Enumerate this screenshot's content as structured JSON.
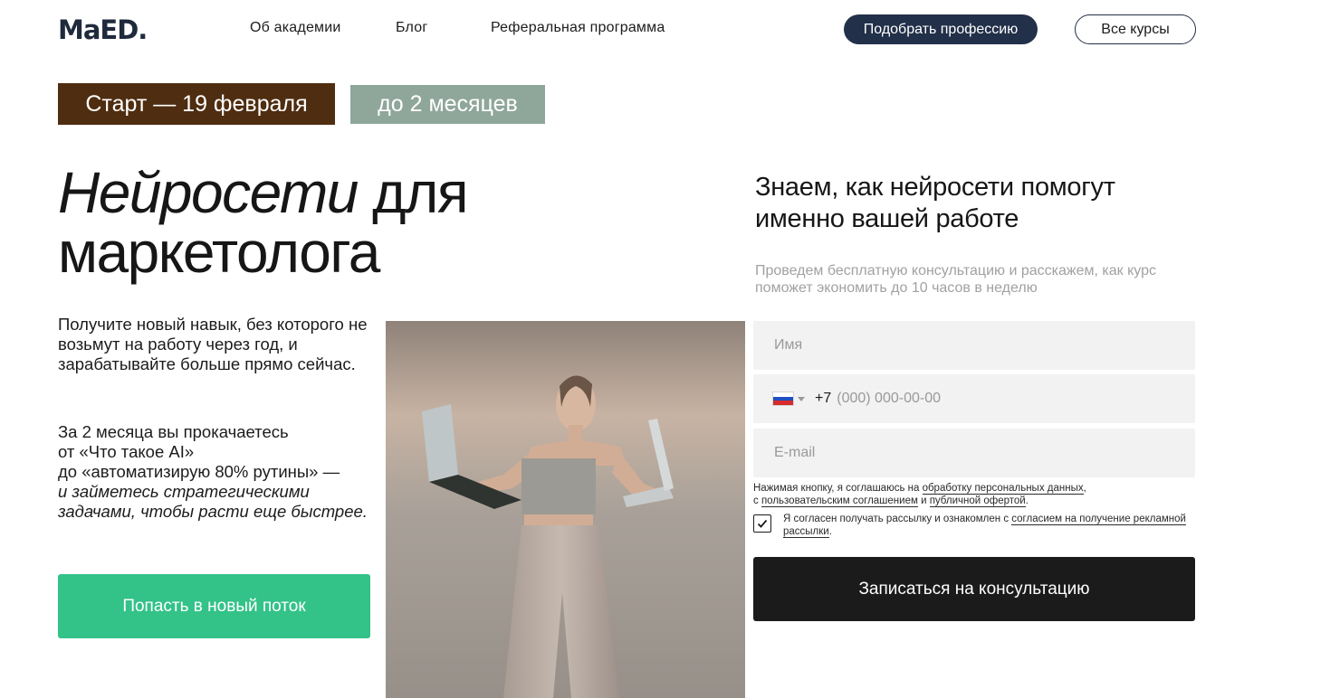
{
  "header": {
    "logo": "MaED.",
    "nav": [
      "Об академии",
      "Блог",
      "Реферальная программа"
    ],
    "pick_profession": "Подобрать профессию",
    "all_courses": "Все курсы"
  },
  "tags": {
    "start": "Старт —  19 февраля",
    "duration": "до 2 месяцев"
  },
  "hero": {
    "title_italic": "Нейросети",
    "title_rest_1": " для",
    "title_rest_2": "маркетолога",
    "para1": "Получите новый навык, без которого не возьмут на работу через год, и зарабатывайте больше прямо сейчас.",
    "para2_line1": "За 2 месяца вы прокачаетесь",
    "para2_line2": "от «Что такое AI»",
    "para2_line3": "до «автоматизирую 80% рутины» —",
    "para2_italic": "и займетесь стратегическими задачами, чтобы расти еще быстрее.",
    "enroll_button": "Попасть в новый поток"
  },
  "form": {
    "title": "Знаем, как нейросети помогут именно вашей работе",
    "subtitle": "Проведем бесплатную консультацию и расскажем, как курс поможет экономить до 10 часов в неделю",
    "name_placeholder": "Имя",
    "phone_code": "+7",
    "phone_placeholder": "(000) 000-00-00",
    "email_placeholder": "E-mail",
    "legal_prefix": "Нажимая кнопку, я соглашаюсь на ",
    "legal_link1": "обработку персональных данных",
    "legal_mid1": ",",
    "legal_mid2": "с ",
    "legal_link2": "пользовательским соглашением",
    "legal_mid3": " и ",
    "legal_link3": "публичной офертой",
    "legal_end": ".",
    "consent_prefix": "Я согласен получать рассылку и ознакомлен с ",
    "consent_link": "согласием на получение рекламной рассылки",
    "consent_end": ".",
    "consent_checked": true,
    "submit_button": "Записаться на консультацию"
  },
  "colors": {
    "brand_dark": "#223049",
    "start_tag": "#4f2d10",
    "duration_tag": "#8fa69b",
    "enroll_green": "#33c288",
    "submit_black": "#1b1b1b"
  }
}
